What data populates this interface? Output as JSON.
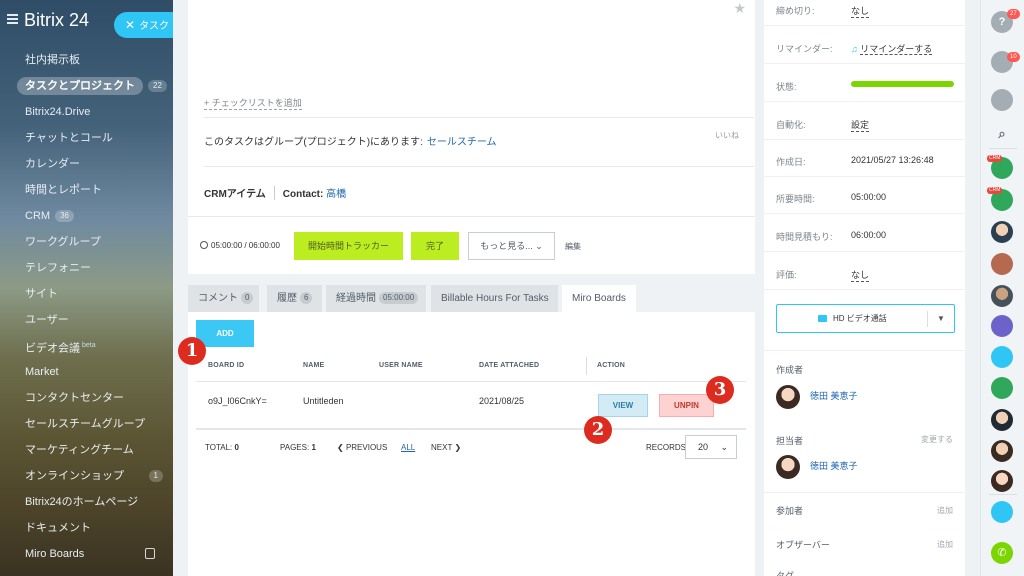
{
  "sidebar": {
    "logo": "Bitrix 24",
    "task_button": "タスク",
    "items": [
      {
        "label": "社内掲示板",
        "counter": ""
      },
      {
        "label": "タスクとプロジェクト",
        "counter": "22"
      },
      {
        "label": "Bitrix24.Drive",
        "counter": ""
      },
      {
        "label": "チャットとコール",
        "counter": ""
      },
      {
        "label": "カレンダー",
        "counter": ""
      },
      {
        "label": "時間とレポート",
        "counter": ""
      },
      {
        "label": "CRM",
        "counter": "36"
      },
      {
        "label": "ワークグループ",
        "counter": ""
      },
      {
        "label": "テレフォニー",
        "counter": ""
      },
      {
        "label": "サイト",
        "counter": ""
      },
      {
        "label": "ユーザー",
        "counter": ""
      },
      {
        "label": "ビデオ会議",
        "counter": "beta"
      },
      {
        "label": "Market",
        "counter": ""
      },
      {
        "label": "コンタクトセンター",
        "counter": ""
      },
      {
        "label": "セールスチームグループ",
        "counter": ""
      },
      {
        "label": "マーケティングチーム",
        "counter": ""
      },
      {
        "label": "オンラインショップ",
        "counter": "1"
      },
      {
        "label": "Bitrix24のホームページ",
        "counter": ""
      },
      {
        "label": "ドキュメント",
        "counter": ""
      },
      {
        "label": "Miro Boards",
        "counter": ""
      }
    ]
  },
  "task": {
    "checklist_link": "+ チェックリストを追加",
    "group_text": "このタスクはグループ(プロジェクト)にあります:",
    "group_link": "セールスチーム",
    "like": "いいね",
    "crm_label": "CRMアイテム",
    "contact_label": "Contact:",
    "contact_name": "高橋",
    "timer": "05:00:00 / 06:00:00",
    "btn_tracker": "開始時間トラッカー",
    "btn_done": "完了",
    "btn_more": "もっと見る...",
    "edit": "編集"
  },
  "tabs": [
    {
      "label": "コメント",
      "count": "0"
    },
    {
      "label": "履歴",
      "count": "6"
    },
    {
      "label": "経過時間",
      "count": "05:00:00"
    },
    {
      "label": "Billable Hours For Tasks",
      "count": ""
    },
    {
      "label": "Miro Boards",
      "count": ""
    }
  ],
  "miro": {
    "add_button": "ADD",
    "columns": [
      "BOARD ID",
      "NAME",
      "USER NAME",
      "DATE ATTACHED",
      "ACTION"
    ],
    "row": {
      "board_id": "o9J_l06CnkY=",
      "name": "Untitleden",
      "user_name": "",
      "date": "2021/08/25"
    },
    "view_button": "VIEW",
    "unpin_button": "UNPIN",
    "pager": {
      "total_label": "TOTAL:",
      "total": "0",
      "pages_label": "PAGES:",
      "pages": "1",
      "prev": "PREVIOUS",
      "all": "ALL",
      "next": "NEXT",
      "records_label": "RECORDS:",
      "records": "20"
    },
    "annotations": [
      "1",
      "2",
      "3"
    ]
  },
  "details": {
    "deadline_label": "締め切り:",
    "deadline": "なし",
    "reminder_label": "リマインダー:",
    "reminder": "リマインダーする",
    "status_label": "状態:",
    "automation_label": "自動化:",
    "automation": "設定",
    "created_label": "作成日:",
    "created": "2021/05/27 13:26:48",
    "required_label": "所要時間:",
    "required": "05:00:00",
    "estimate_label": "時間見積もり:",
    "estimate": "06:00:00",
    "rating_label": "評価:",
    "rating": "なし",
    "video_call": "HD ビデオ通話",
    "creator_label": "作成者",
    "creator": "徳田 美恵子",
    "assignee_label": "担当者",
    "assignee_change": "変更する",
    "assignee": "徳田 美恵子",
    "participants_label": "参加者",
    "participants_add": "追加",
    "observers_label": "オブザーバー",
    "observers_add": "追加",
    "tags_label": "タグ"
  },
  "rightbar": {
    "help_badge": "27",
    "notify_badge": "10",
    "crm_tag": "CRM"
  },
  "colors": {
    "accent_blue": "#2fc6f6",
    "green_button": "#bbed21",
    "annotation_red": "#dd2c1f",
    "link": "#2067b0"
  }
}
